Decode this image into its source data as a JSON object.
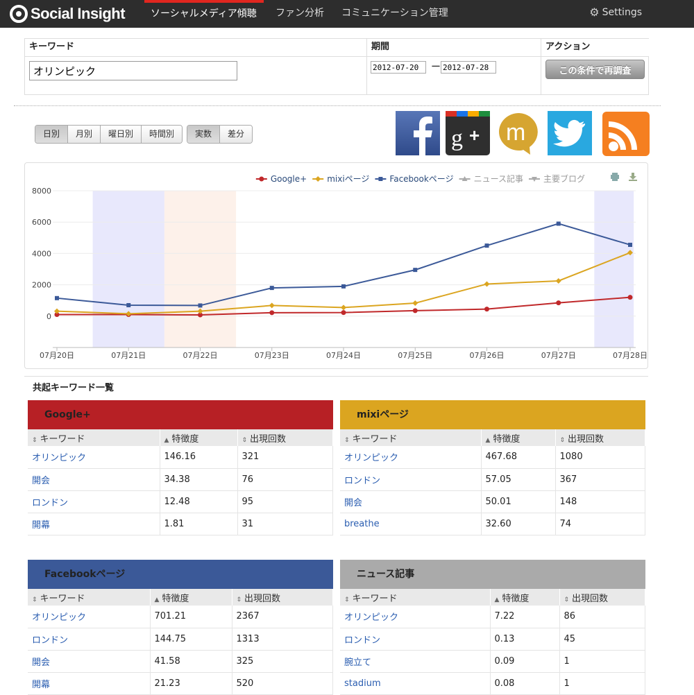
{
  "app": {
    "name": "Social Insight",
    "nav": [
      "ソーシャルメディア傾聴",
      "ファン分析",
      "コミュニケーション管理"
    ],
    "settings": "Settings"
  },
  "form": {
    "keyword_label": "キーワード",
    "period_label": "期間",
    "action_label": "アクション",
    "keyword_value": "オリンピック",
    "date_from": "2012-07-20",
    "date_to": "2012-07-28",
    "date_sep": "ー",
    "button": "この条件で再調査"
  },
  "toggles": {
    "period": [
      "日別",
      "月別",
      "曜日別",
      "時間別"
    ],
    "period_active": 0,
    "mode": [
      "実数",
      "差分"
    ],
    "mode_active": 0
  },
  "social_icons": [
    "facebook-icon",
    "google-plus-icon",
    "mixi-icon",
    "twitter-icon",
    "rss-icon"
  ],
  "chart_data": {
    "type": "line",
    "x": [
      "07月20日",
      "07月21日",
      "07月22日",
      "07月23日",
      "07月24日",
      "07月25日",
      "07月26日",
      "07月27日",
      "07月28日"
    ],
    "ylim": [
      -2000,
      8000
    ],
    "yticks": [
      0,
      2000,
      4000,
      6000,
      8000
    ],
    "series": [
      {
        "name": "Google+",
        "color": "#c0282a",
        "marker": "circle",
        "values": [
          100,
          100,
          80,
          220,
          230,
          350,
          450,
          850,
          1200
        ]
      },
      {
        "name": "mixiページ",
        "color": "#dba520",
        "marker": "diamond",
        "values": [
          320,
          150,
          320,
          680,
          550,
          830,
          2050,
          2250,
          4050
        ]
      },
      {
        "name": "Facebookページ",
        "color": "#3b5998",
        "marker": "square",
        "values": [
          1150,
          700,
          680,
          1800,
          1900,
          2950,
          4500,
          5900,
          4550
        ]
      },
      {
        "name": "ニュース記事",
        "color": "#aaaaaa",
        "marker": "triangle",
        "values": [],
        "hidden": true
      },
      {
        "name": "主要ブログ",
        "color": "#aaaaaa",
        "marker": "triangle-down",
        "values": [],
        "hidden": true
      }
    ],
    "bands": [
      {
        "from": 0.5,
        "to": 1.5,
        "color": "#e8e8fc"
      },
      {
        "from": 1.5,
        "to": 2.5,
        "color": "#fdf1ea"
      },
      {
        "from": 7.5,
        "to": 8.05,
        "color": "#e8e8fc"
      }
    ],
    "grid": true,
    "legend": "top-right"
  },
  "cooccurrence": {
    "title": "共起キーワード一覧",
    "headers": [
      "キーワード",
      "特徴度",
      "出現回数"
    ],
    "panels": [
      {
        "name": "Google+",
        "color": "#b72025",
        "text_color": "#222",
        "rows": [
          [
            "オリンピック",
            "146.16",
            "321"
          ],
          [
            "開会",
            "34.38",
            "76"
          ],
          [
            "ロンドン",
            "12.48",
            "95"
          ],
          [
            "開幕",
            "1.81",
            "31"
          ]
        ]
      },
      {
        "name": "mixiページ",
        "color": "#dba520",
        "text_color": "#222",
        "rows": [
          [
            "オリンピック",
            "467.68",
            "1080"
          ],
          [
            "ロンドン",
            "57.05",
            "367"
          ],
          [
            "開会",
            "50.01",
            "148"
          ],
          [
            "breathe",
            "32.60",
            "74"
          ]
        ]
      },
      {
        "name": "Facebookページ",
        "color": "#3b5998",
        "text_color": "#222",
        "rows": [
          [
            "オリンピック",
            "701.21",
            "2367"
          ],
          [
            "ロンドン",
            "144.75",
            "1313"
          ],
          [
            "開会",
            "41.58",
            "325"
          ],
          [
            "開幕",
            "21.23",
            "520"
          ]
        ]
      },
      {
        "name": "ニュース記事",
        "color": "#aaaaaa",
        "text_color": "#222",
        "rows": [
          [
            "オリンピック",
            "7.22",
            "86"
          ],
          [
            "ロンドン",
            "0.13",
            "45"
          ],
          [
            "腕立て",
            "0.09",
            "1"
          ],
          [
            "stadium",
            "0.08",
            "1"
          ]
        ]
      }
    ]
  }
}
